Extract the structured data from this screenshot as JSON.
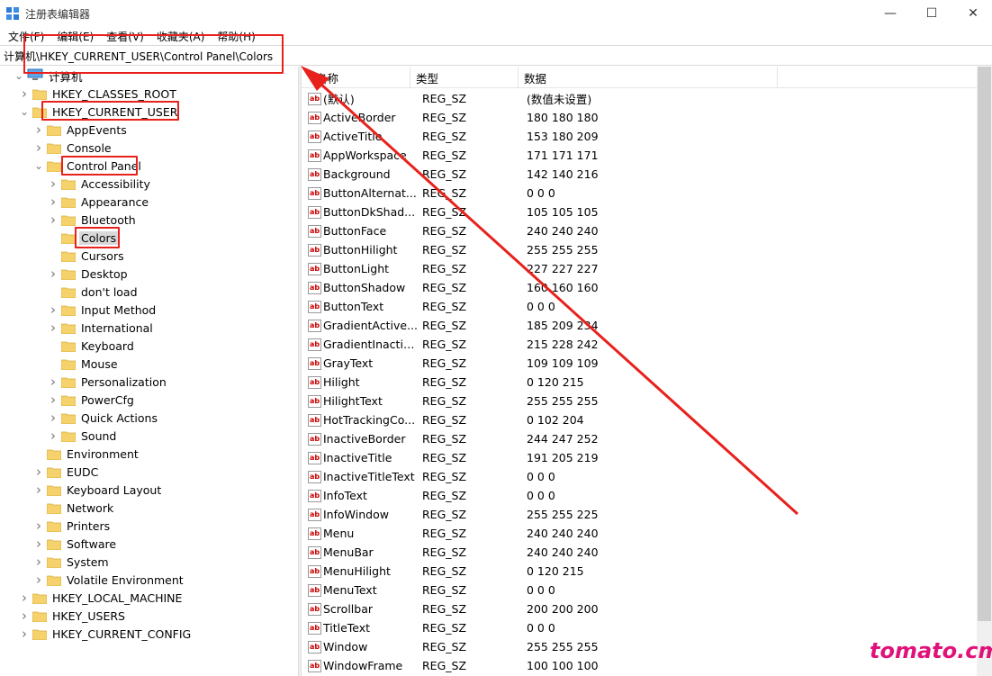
{
  "window": {
    "title": "注册表编辑器",
    "minimize": "—",
    "maximize": "☐",
    "close": "✕"
  },
  "menu": [
    "文件(F)",
    "编辑(E)",
    "查看(V)",
    "收藏夹(A)",
    "帮助(H)"
  ],
  "address": "计算机\\HKEY_CURRENT_USER\\Control Panel\\Colors",
  "tree": [
    {
      "label": "计算机",
      "depth": 0,
      "toggle": "v",
      "icon": "computer"
    },
    {
      "label": "HKEY_CLASSES_ROOT",
      "depth": 1,
      "toggle": ">"
    },
    {
      "label": "HKEY_CURRENT_USER",
      "depth": 1,
      "toggle": "v"
    },
    {
      "label": "AppEvents",
      "depth": 2,
      "toggle": ">"
    },
    {
      "label": "Console",
      "depth": 2,
      "toggle": ">"
    },
    {
      "label": "Control Panel",
      "depth": 2,
      "toggle": "v"
    },
    {
      "label": "Accessibility",
      "depth": 3,
      "toggle": ">"
    },
    {
      "label": "Appearance",
      "depth": 3,
      "toggle": ">"
    },
    {
      "label": "Bluetooth",
      "depth": 3,
      "toggle": ">"
    },
    {
      "label": "Colors",
      "depth": 3,
      "toggle": "",
      "selected": true
    },
    {
      "label": "Cursors",
      "depth": 3,
      "toggle": ""
    },
    {
      "label": "Desktop",
      "depth": 3,
      "toggle": ">"
    },
    {
      "label": "don't load",
      "depth": 3,
      "toggle": ""
    },
    {
      "label": "Input Method",
      "depth": 3,
      "toggle": ">"
    },
    {
      "label": "International",
      "depth": 3,
      "toggle": ">"
    },
    {
      "label": "Keyboard",
      "depth": 3,
      "toggle": ""
    },
    {
      "label": "Mouse",
      "depth": 3,
      "toggle": ""
    },
    {
      "label": "Personalization",
      "depth": 3,
      "toggle": ">"
    },
    {
      "label": "PowerCfg",
      "depth": 3,
      "toggle": ">"
    },
    {
      "label": "Quick Actions",
      "depth": 3,
      "toggle": ">"
    },
    {
      "label": "Sound",
      "depth": 3,
      "toggle": ">"
    },
    {
      "label": "Environment",
      "depth": 2,
      "toggle": ""
    },
    {
      "label": "EUDC",
      "depth": 2,
      "toggle": ">"
    },
    {
      "label": "Keyboard Layout",
      "depth": 2,
      "toggle": ">"
    },
    {
      "label": "Network",
      "depth": 2,
      "toggle": ""
    },
    {
      "label": "Printers",
      "depth": 2,
      "toggle": ">"
    },
    {
      "label": "Software",
      "depth": 2,
      "toggle": ">"
    },
    {
      "label": "System",
      "depth": 2,
      "toggle": ">"
    },
    {
      "label": "Volatile Environment",
      "depth": 2,
      "toggle": ">"
    },
    {
      "label": "HKEY_LOCAL_MACHINE",
      "depth": 1,
      "toggle": ">"
    },
    {
      "label": "HKEY_USERS",
      "depth": 1,
      "toggle": ">"
    },
    {
      "label": "HKEY_CURRENT_CONFIG",
      "depth": 1,
      "toggle": ">"
    }
  ],
  "list": {
    "columns": [
      "名称",
      "类型",
      "数据"
    ],
    "rows": [
      {
        "name": "(默认)",
        "type": "REG_SZ",
        "data": "(数值未设置)"
      },
      {
        "name": "ActiveBorder",
        "type": "REG_SZ",
        "data": "180 180 180"
      },
      {
        "name": "ActiveTitle",
        "type": "REG_SZ",
        "data": "153 180 209"
      },
      {
        "name": "AppWorkspace",
        "type": "REG_SZ",
        "data": "171 171 171"
      },
      {
        "name": "Background",
        "type": "REG_SZ",
        "data": "142 140 216"
      },
      {
        "name": "ButtonAlternat...",
        "type": "REG_SZ",
        "data": "0 0 0"
      },
      {
        "name": "ButtonDkShad...",
        "type": "REG_SZ",
        "data": "105 105 105"
      },
      {
        "name": "ButtonFace",
        "type": "REG_SZ",
        "data": "240 240 240"
      },
      {
        "name": "ButtonHilight",
        "type": "REG_SZ",
        "data": "255 255 255"
      },
      {
        "name": "ButtonLight",
        "type": "REG_SZ",
        "data": "227 227 227"
      },
      {
        "name": "ButtonShadow",
        "type": "REG_SZ",
        "data": "160 160 160"
      },
      {
        "name": "ButtonText",
        "type": "REG_SZ",
        "data": "0 0 0"
      },
      {
        "name": "GradientActive...",
        "type": "REG_SZ",
        "data": "185 209 234"
      },
      {
        "name": "GradientInactiv...",
        "type": "REG_SZ",
        "data": "215 228 242"
      },
      {
        "name": "GrayText",
        "type": "REG_SZ",
        "data": "109 109 109"
      },
      {
        "name": "Hilight",
        "type": "REG_SZ",
        "data": "0 120 215"
      },
      {
        "name": "HilightText",
        "type": "REG_SZ",
        "data": "255 255 255"
      },
      {
        "name": "HotTrackingCo...",
        "type": "REG_SZ",
        "data": "0 102 204"
      },
      {
        "name": "InactiveBorder",
        "type": "REG_SZ",
        "data": "244 247 252"
      },
      {
        "name": "InactiveTitle",
        "type": "REG_SZ",
        "data": "191 205 219"
      },
      {
        "name": "InactiveTitleText",
        "type": "REG_SZ",
        "data": "0 0 0"
      },
      {
        "name": "InfoText",
        "type": "REG_SZ",
        "data": "0 0 0"
      },
      {
        "name": "InfoWindow",
        "type": "REG_SZ",
        "data": "255 255 225"
      },
      {
        "name": "Menu",
        "type": "REG_SZ",
        "data": "240 240 240"
      },
      {
        "name": "MenuBar",
        "type": "REG_SZ",
        "data": "240 240 240"
      },
      {
        "name": "MenuHilight",
        "type": "REG_SZ",
        "data": "0 120 215"
      },
      {
        "name": "MenuText",
        "type": "REG_SZ",
        "data": "0 0 0"
      },
      {
        "name": "Scrollbar",
        "type": "REG_SZ",
        "data": "200 200 200"
      },
      {
        "name": "TitleText",
        "type": "REG_SZ",
        "data": "0 0 0"
      },
      {
        "name": "Window",
        "type": "REG_SZ",
        "data": "255 255 255"
      },
      {
        "name": "WindowFrame",
        "type": "REG_SZ",
        "data": "100 100 100"
      }
    ]
  },
  "watermark": "tomato.cm",
  "colors": {
    "annotation_red": "#e8211c",
    "folder_yellow": "#f5d26b",
    "watermark": "#e0127a"
  }
}
